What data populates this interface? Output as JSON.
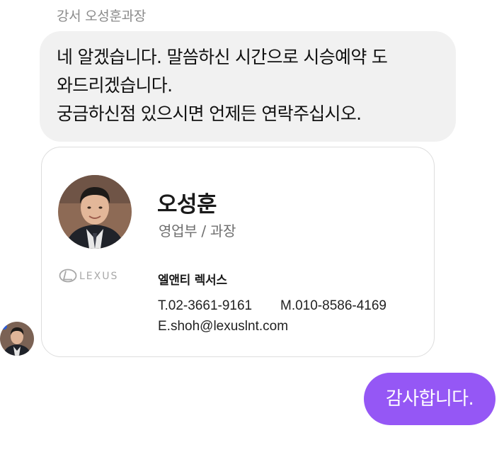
{
  "sender": {
    "name": "강서 오성훈과장"
  },
  "incoming_message": {
    "lines": [
      "네 알겠습니다. 말씀하신 시간으로 시승예약 도",
      "와드리겠습니다.",
      "궁금하신점 있으시면 언제든 연락주십시오."
    ]
  },
  "business_card": {
    "name": "오성훈",
    "title": "영업부 / 과장",
    "logo_text": "LEXUS",
    "company": "엘앤티 렉서스",
    "phone": "T.02-3661-9161",
    "mobile": "M.010-8586-4169",
    "email": "E.shoh@lexuslnt.com"
  },
  "outgoing_message": {
    "text": "감사합니다."
  },
  "colors": {
    "incoming_bubble": "#f1f1f1",
    "outgoing_bubble": "#9557f5",
    "card_border": "#dddddd",
    "muted_text": "#8a8a8a"
  },
  "icons": {
    "card_photo": "profile-photo",
    "sender_avatar": "avatar",
    "logo": "lexus-logo-icon"
  }
}
